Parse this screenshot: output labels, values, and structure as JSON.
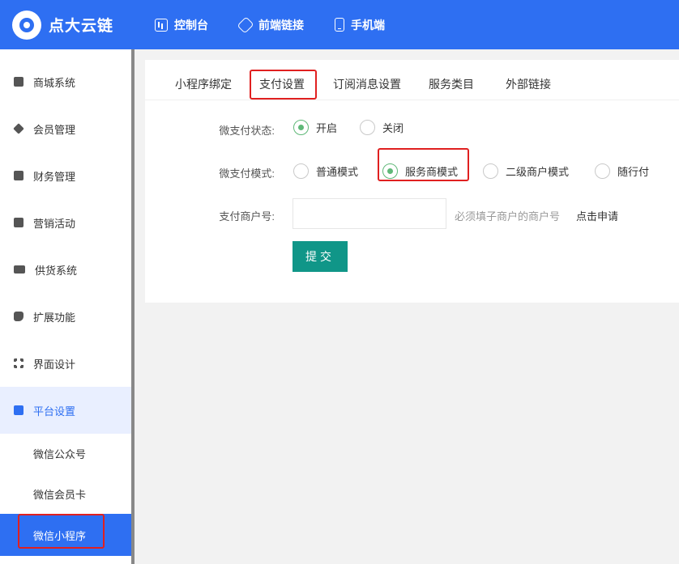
{
  "app": {
    "title": "点大云链"
  },
  "topnav": [
    {
      "label": "控制台",
      "icon": "console-icon"
    },
    {
      "label": "前端链接",
      "icon": "link-icon"
    },
    {
      "label": "手机端",
      "icon": "mobile-icon"
    }
  ],
  "sidebar": {
    "items": [
      {
        "label": "商城系统",
        "icon": "bag-icon"
      },
      {
        "label": "会员管理",
        "icon": "diamond-icon"
      },
      {
        "label": "财务管理",
        "icon": "yen-icon"
      },
      {
        "label": "营销活动",
        "icon": "gift-icon"
      },
      {
        "label": "供货系统",
        "icon": "truck-icon"
      },
      {
        "label": "扩展功能",
        "icon": "puzzle-icon"
      },
      {
        "label": "界面设计",
        "icon": "grid-icon"
      },
      {
        "label": "平台设置",
        "icon": "settings-card-icon"
      }
    ],
    "sub_items": [
      "微信公众号",
      "微信会员卡",
      "微信小程序"
    ]
  },
  "tabs": [
    "小程序绑定",
    "支付设置",
    "订阅消息设置",
    "服务类目",
    "外部链接"
  ],
  "form": {
    "pay_status_label": "微支付状态:",
    "pay_status_options": [
      "开启",
      "关闭"
    ],
    "pay_mode_label": "微支付模式:",
    "pay_mode_options": [
      "普通模式",
      "服务商模式",
      "二级商户模式",
      "随行付"
    ],
    "merchant_label": "支付商户号:",
    "merchant_value": "",
    "merchant_hint": "必须填子商户的商户号",
    "apply_link": "点击申请",
    "submit_label": "提交"
  },
  "colors": {
    "primary": "#2e6ff2",
    "submit": "#109688",
    "radio_checked": "#5fb878",
    "highlight": "#e02020"
  }
}
